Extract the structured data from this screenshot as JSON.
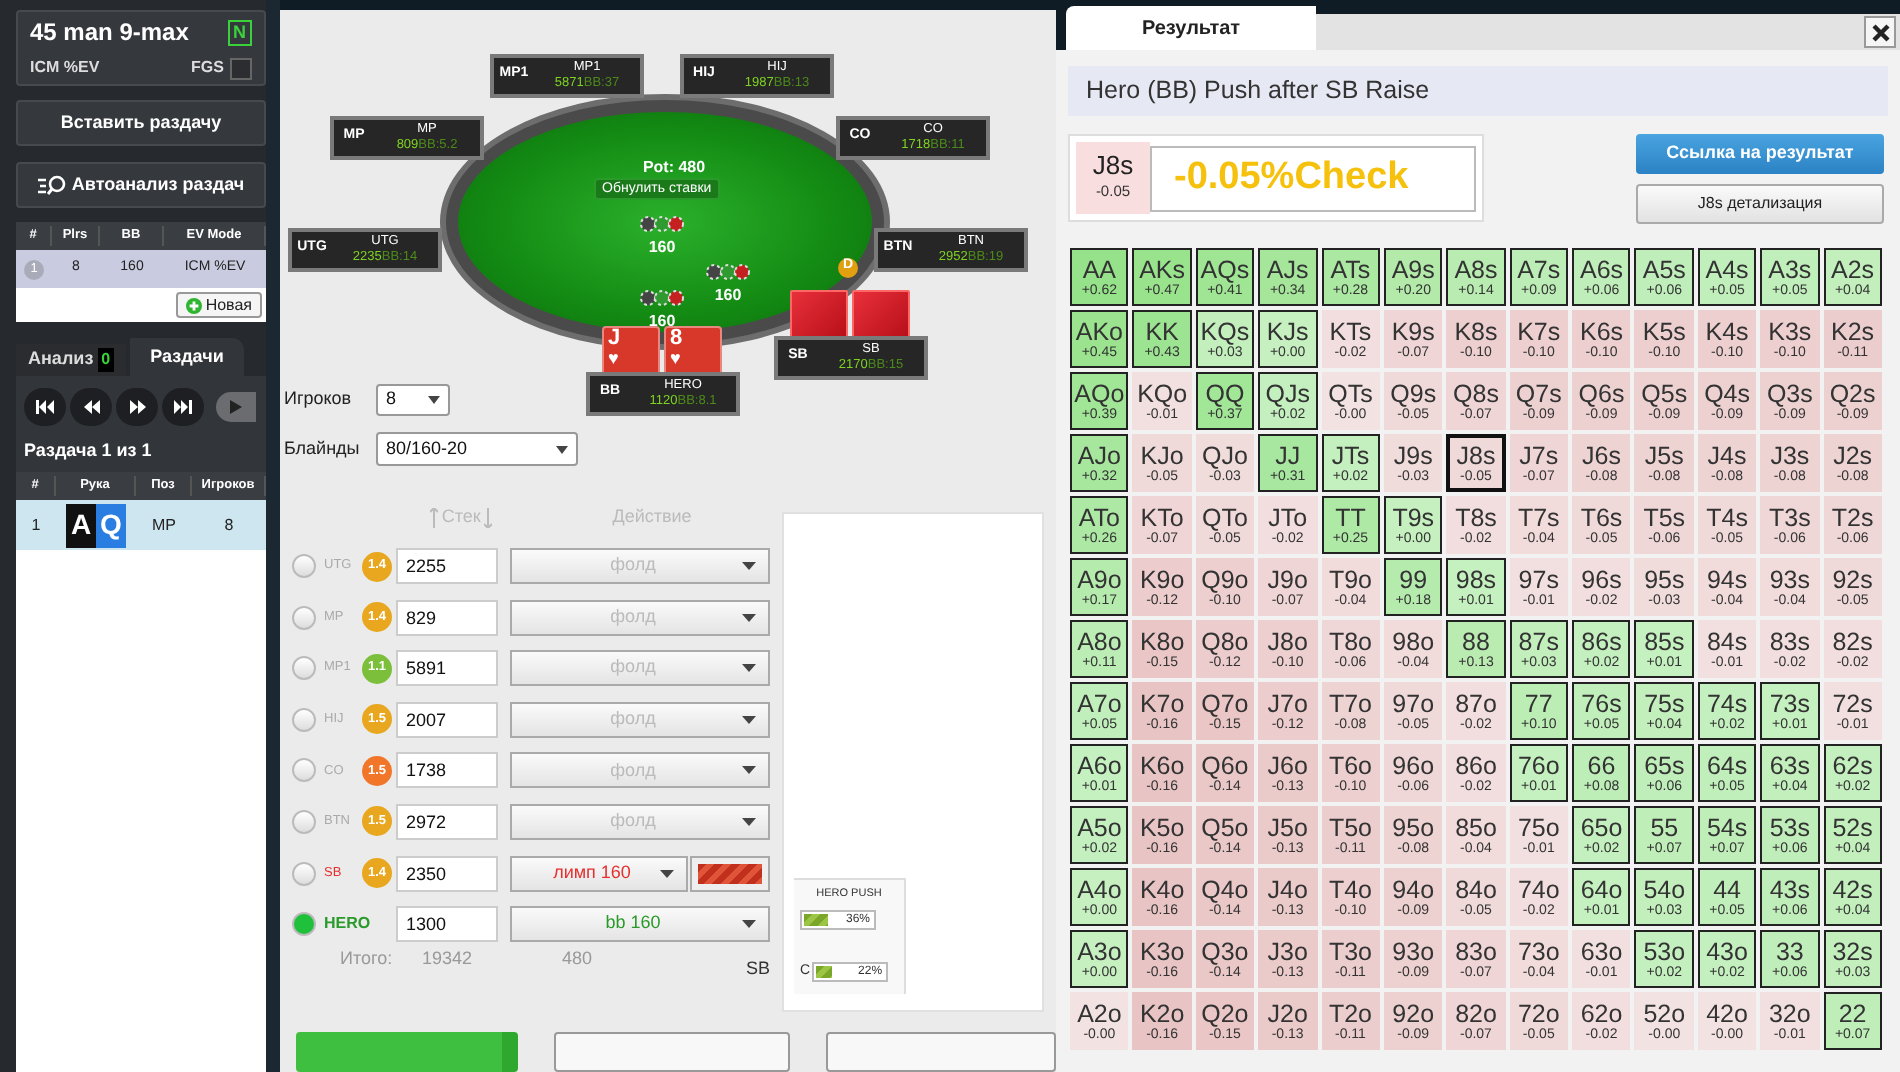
{
  "sidebar": {
    "tournament": "45 man 9-max",
    "badge": "N",
    "ev_mode": "ICM %EV",
    "fgs_label": "FGS",
    "fgs_checked": false,
    "paste_button": "Вставить раздачу",
    "autoanalysis_button": "Автоанализ раздач",
    "analyses": {
      "columns": [
        "#",
        "Plrs",
        "BB",
        "EV Mode"
      ],
      "rows": [
        {
          "cells": [
            "1",
            "8",
            "160",
            "ICM %EV"
          ],
          "selected": true
        }
      ],
      "new_button": "Новая"
    },
    "tabs": [
      {
        "label": "Анализ",
        "count": "0",
        "selected": false
      },
      {
        "label": "Раздачи",
        "selected": true
      }
    ],
    "hand_counter": "Раздача 1 из 1",
    "hands": {
      "columns": [
        "#",
        "Рука",
        "Поз",
        "Игроков"
      ],
      "rows": [
        {
          "number": "1",
          "cards": [
            {
              "rank": "A",
              "color": "#111111"
            },
            {
              "rank": "Q",
              "color": "#2a7de1"
            }
          ],
          "position": "MP",
          "players": "8",
          "selected": true
        }
      ]
    }
  },
  "table": {
    "seats": [
      {
        "tag": "MP1",
        "name": "MP1",
        "stack": "5871",
        "bb": "BB:37",
        "face_down_cards": false
      },
      {
        "tag": "HIJ",
        "name": "HIJ",
        "stack": "1987",
        "bb": "BB:13",
        "face_down_cards": false
      },
      {
        "tag": "MP",
        "name": "MP",
        "stack": "809",
        "bb": "BB:5.2",
        "face_down_cards": false
      },
      {
        "tag": "CO",
        "name": "CO",
        "stack": "1718",
        "bb": "BB:11",
        "face_down_cards": false
      },
      {
        "tag": "UTG",
        "name": "UTG",
        "stack": "2235",
        "bb": "BB:14",
        "face_down_cards": false
      },
      {
        "tag": "BTN",
        "name": "BTN",
        "stack": "2952",
        "bb": "BB:19",
        "face_down_cards": false
      },
      {
        "tag": "SB",
        "name": "SB",
        "stack": "2170",
        "bb": "BB:15",
        "face_down_cards": true
      },
      {
        "tag": "BB",
        "name": "HERO",
        "stack": "1120",
        "bb": "BB:8.1",
        "face_down_cards": false
      }
    ],
    "pot": "Pot: 480",
    "reset_button": "Обнулить ставки",
    "bets": [
      "160",
      "160",
      "160"
    ],
    "dealer": "D",
    "hero_cards": [
      {
        "rank": "J",
        "suit": "♥"
      },
      {
        "rank": "8",
        "suit": "♥"
      }
    ]
  },
  "players_select": {
    "label": "Игроков",
    "value": "8"
  },
  "blinds_select": {
    "label": "Блайнды",
    "value": "80/160-20"
  },
  "actions": {
    "stack_header": "Стек",
    "action_header": "Действие",
    "rows": [
      {
        "position": "UTG",
        "badge": "1.4",
        "color": "#e8a71f",
        "stack": "2255",
        "action": "фолд",
        "kind": "fold",
        "selected": false
      },
      {
        "position": "MP",
        "badge": "1.4",
        "color": "#e8a71f",
        "stack": "829",
        "action": "фолд",
        "kind": "fold",
        "selected": false
      },
      {
        "position": "MP1",
        "badge": "1.1",
        "color": "#7cbf3a",
        "stack": "5891",
        "action": "фолд",
        "kind": "fold",
        "selected": false
      },
      {
        "position": "HIJ",
        "badge": "1.5",
        "color": "#e8a71f",
        "stack": "2007",
        "action": "фолд",
        "kind": "fold",
        "selected": false
      },
      {
        "position": "CO",
        "badge": "1.5",
        "color": "#f2762a",
        "stack": "1738",
        "action": "фолд",
        "kind": "fold",
        "selected": false
      },
      {
        "position": "BTN",
        "badge": "1.5",
        "color": "#e8a71f",
        "stack": "2972",
        "action": "фолд",
        "kind": "fold",
        "selected": false
      },
      {
        "position": "SB",
        "badge": "1.4",
        "color": "#e8a71f",
        "stack": "2350",
        "action": "лимп 160",
        "kind": "limp",
        "level": 1,
        "selected": false
      },
      {
        "position": "HERO",
        "stack": "1300",
        "action": "bb 160",
        "kind": "hero",
        "selected": true
      }
    ],
    "total_label": "Итого:",
    "total_stack": "19342",
    "total_pot": "480",
    "sb_label": "SB"
  },
  "range_panel": {
    "title": "HERO PUSH",
    "bars": [
      {
        "value": "36%",
        "level": 0.36
      },
      {
        "label": "C",
        "value": "22%",
        "level": 0.22
      }
    ]
  },
  "result": {
    "tab": "Результат",
    "title": "Hero (BB) Push after SB Raise",
    "hand": "J8s",
    "hand_ev": "-0.05",
    "verdict": "-0.05%Check",
    "link_button": "Ссылка на результат",
    "details_button": "J8s детализация",
    "grid": [
      [
        {
          "hand": "AA",
          "ev": "+0.62",
          "push": true,
          "selected": false
        },
        {
          "hand": "AKs",
          "ev": "+0.47",
          "push": true,
          "selected": false
        },
        {
          "hand": "AQs",
          "ev": "+0.41",
          "push": true,
          "selected": false
        },
        {
          "hand": "AJs",
          "ev": "+0.34",
          "push": true,
          "selected": false
        },
        {
          "hand": "ATs",
          "ev": "+0.28",
          "push": true,
          "selected": false
        },
        {
          "hand": "A9s",
          "ev": "+0.20",
          "push": true,
          "selected": false
        },
        {
          "hand": "A8s",
          "ev": "+0.14",
          "push": true,
          "selected": false
        },
        {
          "hand": "A7s",
          "ev": "+0.09",
          "push": true,
          "selected": false
        },
        {
          "hand": "A6s",
          "ev": "+0.06",
          "push": true,
          "selected": false
        },
        {
          "hand": "A5s",
          "ev": "+0.06",
          "push": true,
          "selected": false
        },
        {
          "hand": "A4s",
          "ev": "+0.05",
          "push": true,
          "selected": false
        },
        {
          "hand": "A3s",
          "ev": "+0.05",
          "push": true,
          "selected": false
        },
        {
          "hand": "A2s",
          "ev": "+0.04",
          "push": true,
          "selected": false
        }
      ],
      [
        {
          "hand": "AKo",
          "ev": "+0.45",
          "push": true,
          "selected": false
        },
        {
          "hand": "KK",
          "ev": "+0.43",
          "push": true,
          "selected": false
        },
        {
          "hand": "KQs",
          "ev": "+0.03",
          "push": true,
          "selected": false
        },
        {
          "hand": "KJs",
          "ev": "+0.00",
          "push": true,
          "selected": false
        },
        {
          "hand": "KTs",
          "ev": "-0.02",
          "push": false,
          "selected": false
        },
        {
          "hand": "K9s",
          "ev": "-0.07",
          "push": false,
          "selected": false
        },
        {
          "hand": "K8s",
          "ev": "-0.10",
          "push": false,
          "selected": false
        },
        {
          "hand": "K7s",
          "ev": "-0.10",
          "push": false,
          "selected": false
        },
        {
          "hand": "K6s",
          "ev": "-0.10",
          "push": false,
          "selected": false
        },
        {
          "hand": "K5s",
          "ev": "-0.10",
          "push": false,
          "selected": false
        },
        {
          "hand": "K4s",
          "ev": "-0.10",
          "push": false,
          "selected": false
        },
        {
          "hand": "K3s",
          "ev": "-0.10",
          "push": false,
          "selected": false
        },
        {
          "hand": "K2s",
          "ev": "-0.11",
          "push": false,
          "selected": false
        }
      ],
      [
        {
          "hand": "AQo",
          "ev": "+0.39",
          "push": true,
          "selected": false
        },
        {
          "hand": "KQo",
          "ev": "-0.01",
          "push": false,
          "selected": false
        },
        {
          "hand": "QQ",
          "ev": "+0.37",
          "push": true,
          "selected": false
        },
        {
          "hand": "QJs",
          "ev": "+0.02",
          "push": true,
          "selected": false
        },
        {
          "hand": "QTs",
          "ev": "-0.00",
          "push": false,
          "selected": false
        },
        {
          "hand": "Q9s",
          "ev": "-0.05",
          "push": false,
          "selected": false
        },
        {
          "hand": "Q8s",
          "ev": "-0.07",
          "push": false,
          "selected": false
        },
        {
          "hand": "Q7s",
          "ev": "-0.09",
          "push": false,
          "selected": false
        },
        {
          "hand": "Q6s",
          "ev": "-0.09",
          "push": false,
          "selected": false
        },
        {
          "hand": "Q5s",
          "ev": "-0.09",
          "push": false,
          "selected": false
        },
        {
          "hand": "Q4s",
          "ev": "-0.09",
          "push": false,
          "selected": false
        },
        {
          "hand": "Q3s",
          "ev": "-0.09",
          "push": false,
          "selected": false
        },
        {
          "hand": "Q2s",
          "ev": "-0.09",
          "push": false,
          "selected": false
        }
      ],
      [
        {
          "hand": "AJo",
          "ev": "+0.32",
          "push": true,
          "selected": false
        },
        {
          "hand": "KJo",
          "ev": "-0.05",
          "push": false,
          "selected": false
        },
        {
          "hand": "QJo",
          "ev": "-0.03",
          "push": false,
          "selected": false
        },
        {
          "hand": "JJ",
          "ev": "+0.31",
          "push": true,
          "selected": false
        },
        {
          "hand": "JTs",
          "ev": "+0.02",
          "push": true,
          "selected": false
        },
        {
          "hand": "J9s",
          "ev": "-0.03",
          "push": false,
          "selected": false
        },
        {
          "hand": "J8s",
          "ev": "-0.05",
          "push": false,
          "selected": true
        },
        {
          "hand": "J7s",
          "ev": "-0.07",
          "push": false,
          "selected": false
        },
        {
          "hand": "J6s",
          "ev": "-0.08",
          "push": false,
          "selected": false
        },
        {
          "hand": "J5s",
          "ev": "-0.08",
          "push": false,
          "selected": false
        },
        {
          "hand": "J4s",
          "ev": "-0.08",
          "push": false,
          "selected": false
        },
        {
          "hand": "J3s",
          "ev": "-0.08",
          "push": false,
          "selected": false
        },
        {
          "hand": "J2s",
          "ev": "-0.08",
          "push": false,
          "selected": false
        }
      ],
      [
        {
          "hand": "ATo",
          "ev": "+0.26",
          "push": true,
          "selected": false
        },
        {
          "hand": "KTo",
          "ev": "-0.07",
          "push": false,
          "selected": false
        },
        {
          "hand": "QTo",
          "ev": "-0.05",
          "push": false,
          "selected": false
        },
        {
          "hand": "JTo",
          "ev": "-0.02",
          "push": false,
          "selected": false
        },
        {
          "hand": "TT",
          "ev": "+0.25",
          "push": true,
          "selected": false
        },
        {
          "hand": "T9s",
          "ev": "+0.00",
          "push": true,
          "selected": false
        },
        {
          "hand": "T8s",
          "ev": "-0.02",
          "push": false,
          "selected": false
        },
        {
          "hand": "T7s",
          "ev": "-0.04",
          "push": false,
          "selected": false
        },
        {
          "hand": "T6s",
          "ev": "-0.05",
          "push": false,
          "selected": false
        },
        {
          "hand": "T5s",
          "ev": "-0.06",
          "push": false,
          "selected": false
        },
        {
          "hand": "T4s",
          "ev": "-0.05",
          "push": false,
          "selected": false
        },
        {
          "hand": "T3s",
          "ev": "-0.06",
          "push": false,
          "selected": false
        },
        {
          "hand": "T2s",
          "ev": "-0.06",
          "push": false,
          "selected": false
        }
      ],
      [
        {
          "hand": "A9o",
          "ev": "+0.17",
          "push": true,
          "selected": false
        },
        {
          "hand": "K9o",
          "ev": "-0.12",
          "push": false,
          "selected": false
        },
        {
          "hand": "Q9o",
          "ev": "-0.10",
          "push": false,
          "selected": false
        },
        {
          "hand": "J9o",
          "ev": "-0.07",
          "push": false,
          "selected": false
        },
        {
          "hand": "T9o",
          "ev": "-0.04",
          "push": false,
          "selected": false
        },
        {
          "hand": "99",
          "ev": "+0.18",
          "push": true,
          "selected": false
        },
        {
          "hand": "98s",
          "ev": "+0.01",
          "push": true,
          "selected": false
        },
        {
          "hand": "97s",
          "ev": "-0.01",
          "push": false,
          "selected": false
        },
        {
          "hand": "96s",
          "ev": "-0.02",
          "push": false,
          "selected": false
        },
        {
          "hand": "95s",
          "ev": "-0.03",
          "push": false,
          "selected": false
        },
        {
          "hand": "94s",
          "ev": "-0.04",
          "push": false,
          "selected": false
        },
        {
          "hand": "93s",
          "ev": "-0.04",
          "push": false,
          "selected": false
        },
        {
          "hand": "92s",
          "ev": "-0.05",
          "push": false,
          "selected": false
        }
      ],
      [
        {
          "hand": "A8o",
          "ev": "+0.11",
          "push": true,
          "selected": false
        },
        {
          "hand": "K8o",
          "ev": "-0.15",
          "push": false,
          "selected": false
        },
        {
          "hand": "Q8o",
          "ev": "-0.12",
          "push": false,
          "selected": false
        },
        {
          "hand": "J8o",
          "ev": "-0.10",
          "push": false,
          "selected": false
        },
        {
          "hand": "T8o",
          "ev": "-0.06",
          "push": false,
          "selected": false
        },
        {
          "hand": "98o",
          "ev": "-0.04",
          "push": false,
          "selected": false
        },
        {
          "hand": "88",
          "ev": "+0.13",
          "push": true,
          "selected": false
        },
        {
          "hand": "87s",
          "ev": "+0.03",
          "push": true,
          "selected": false
        },
        {
          "hand": "86s",
          "ev": "+0.02",
          "push": true,
          "selected": false
        },
        {
          "hand": "85s",
          "ev": "+0.01",
          "push": true,
          "selected": false
        },
        {
          "hand": "84s",
          "ev": "-0.01",
          "push": false,
          "selected": false
        },
        {
          "hand": "83s",
          "ev": "-0.02",
          "push": false,
          "selected": false
        },
        {
          "hand": "82s",
          "ev": "-0.02",
          "push": false,
          "selected": false
        }
      ],
      [
        {
          "hand": "A7o",
          "ev": "+0.05",
          "push": true,
          "selected": false
        },
        {
          "hand": "K7o",
          "ev": "-0.16",
          "push": false,
          "selected": false
        },
        {
          "hand": "Q7o",
          "ev": "-0.15",
          "push": false,
          "selected": false
        },
        {
          "hand": "J7o",
          "ev": "-0.12",
          "push": false,
          "selected": false
        },
        {
          "hand": "T7o",
          "ev": "-0.08",
          "push": false,
          "selected": false
        },
        {
          "hand": "97o",
          "ev": "-0.05",
          "push": false,
          "selected": false
        },
        {
          "hand": "87o",
          "ev": "-0.02",
          "push": false,
          "selected": false
        },
        {
          "hand": "77",
          "ev": "+0.10",
          "push": true,
          "selected": false
        },
        {
          "hand": "76s",
          "ev": "+0.05",
          "push": true,
          "selected": false
        },
        {
          "hand": "75s",
          "ev": "+0.04",
          "push": true,
          "selected": false
        },
        {
          "hand": "74s",
          "ev": "+0.02",
          "push": true,
          "selected": false
        },
        {
          "hand": "73s",
          "ev": "+0.01",
          "push": true,
          "selected": false
        },
        {
          "hand": "72s",
          "ev": "-0.01",
          "push": false,
          "selected": false
        }
      ],
      [
        {
          "hand": "A6o",
          "ev": "+0.01",
          "push": true,
          "selected": false
        },
        {
          "hand": "K6o",
          "ev": "-0.16",
          "push": false,
          "selected": false
        },
        {
          "hand": "Q6o",
          "ev": "-0.14",
          "push": false,
          "selected": false
        },
        {
          "hand": "J6o",
          "ev": "-0.13",
          "push": false,
          "selected": false
        },
        {
          "hand": "T6o",
          "ev": "-0.10",
          "push": false,
          "selected": false
        },
        {
          "hand": "96o",
          "ev": "-0.06",
          "push": false,
          "selected": false
        },
        {
          "hand": "86o",
          "ev": "-0.02",
          "push": false,
          "selected": false
        },
        {
          "hand": "76o",
          "ev": "+0.01",
          "push": true,
          "selected": false
        },
        {
          "hand": "66",
          "ev": "+0.08",
          "push": true,
          "selected": false
        },
        {
          "hand": "65s",
          "ev": "+0.06",
          "push": true,
          "selected": false
        },
        {
          "hand": "64s",
          "ev": "+0.05",
          "push": true,
          "selected": false
        },
        {
          "hand": "63s",
          "ev": "+0.04",
          "push": true,
          "selected": false
        },
        {
          "hand": "62s",
          "ev": "+0.02",
          "push": true,
          "selected": false
        }
      ],
      [
        {
          "hand": "A5o",
          "ev": "+0.02",
          "push": true,
          "selected": false
        },
        {
          "hand": "K5o",
          "ev": "-0.16",
          "push": false,
          "selected": false
        },
        {
          "hand": "Q5o",
          "ev": "-0.14",
          "push": false,
          "selected": false
        },
        {
          "hand": "J5o",
          "ev": "-0.13",
          "push": false,
          "selected": false
        },
        {
          "hand": "T5o",
          "ev": "-0.11",
          "push": false,
          "selected": false
        },
        {
          "hand": "95o",
          "ev": "-0.08",
          "push": false,
          "selected": false
        },
        {
          "hand": "85o",
          "ev": "-0.04",
          "push": false,
          "selected": false
        },
        {
          "hand": "75o",
          "ev": "-0.01",
          "push": false,
          "selected": false
        },
        {
          "hand": "65o",
          "ev": "+0.02",
          "push": true,
          "selected": false
        },
        {
          "hand": "55",
          "ev": "+0.07",
          "push": true,
          "selected": false
        },
        {
          "hand": "54s",
          "ev": "+0.07",
          "push": true,
          "selected": false
        },
        {
          "hand": "53s",
          "ev": "+0.06",
          "push": true,
          "selected": false
        },
        {
          "hand": "52s",
          "ev": "+0.04",
          "push": true,
          "selected": false
        }
      ],
      [
        {
          "hand": "A4o",
          "ev": "+0.00",
          "push": true,
          "selected": false
        },
        {
          "hand": "K4o",
          "ev": "-0.16",
          "push": false,
          "selected": false
        },
        {
          "hand": "Q4o",
          "ev": "-0.14",
          "push": false,
          "selected": false
        },
        {
          "hand": "J4o",
          "ev": "-0.13",
          "push": false,
          "selected": false
        },
        {
          "hand": "T4o",
          "ev": "-0.10",
          "push": false,
          "selected": false
        },
        {
          "hand": "94o",
          "ev": "-0.09",
          "push": false,
          "selected": false
        },
        {
          "hand": "84o",
          "ev": "-0.05",
          "push": false,
          "selected": false
        },
        {
          "hand": "74o",
          "ev": "-0.02",
          "push": false,
          "selected": false
        },
        {
          "hand": "64o",
          "ev": "+0.01",
          "push": true,
          "selected": false
        },
        {
          "hand": "54o",
          "ev": "+0.03",
          "push": true,
          "selected": false
        },
        {
          "hand": "44",
          "ev": "+0.05",
          "push": true,
          "selected": false
        },
        {
          "hand": "43s",
          "ev": "+0.06",
          "push": true,
          "selected": false
        },
        {
          "hand": "42s",
          "ev": "+0.04",
          "push": true,
          "selected": false
        }
      ],
      [
        {
          "hand": "A3o",
          "ev": "+0.00",
          "push": true,
          "selected": false
        },
        {
          "hand": "K3o",
          "ev": "-0.16",
          "push": false,
          "selected": false
        },
        {
          "hand": "Q3o",
          "ev": "-0.14",
          "push": false,
          "selected": false
        },
        {
          "hand": "J3o",
          "ev": "-0.13",
          "push": false,
          "selected": false
        },
        {
          "hand": "T3o",
          "ev": "-0.11",
          "push": false,
          "selected": false
        },
        {
          "hand": "93o",
          "ev": "-0.09",
          "push": false,
          "selected": false
        },
        {
          "hand": "83o",
          "ev": "-0.07",
          "push": false,
          "selected": false
        },
        {
          "hand": "73o",
          "ev": "-0.04",
          "push": false,
          "selected": false
        },
        {
          "hand": "63o",
          "ev": "-0.01",
          "push": false,
          "selected": false
        },
        {
          "hand": "53o",
          "ev": "+0.02",
          "push": true,
          "selected": false
        },
        {
          "hand": "43o",
          "ev": "+0.02",
          "push": true,
          "selected": false
        },
        {
          "hand": "33",
          "ev": "+0.06",
          "push": true,
          "selected": false
        },
        {
          "hand": "32s",
          "ev": "+0.03",
          "push": true,
          "selected": false
        }
      ],
      [
        {
          "hand": "A2o",
          "ev": "-0.00",
          "push": false,
          "selected": false
        },
        {
          "hand": "K2o",
          "ev": "-0.16",
          "push": false,
          "selected": false
        },
        {
          "hand": "Q2o",
          "ev": "-0.15",
          "push": false,
          "selected": false
        },
        {
          "hand": "J2o",
          "ev": "-0.13",
          "push": false,
          "selected": false
        },
        {
          "hand": "T2o",
          "ev": "-0.11",
          "push": false,
          "selected": false
        },
        {
          "hand": "92o",
          "ev": "-0.09",
          "push": false,
          "selected": false
        },
        {
          "hand": "82o",
          "ev": "-0.07",
          "push": false,
          "selected": false
        },
        {
          "hand": "72o",
          "ev": "-0.05",
          "push": false,
          "selected": false
        },
        {
          "hand": "62o",
          "ev": "-0.02",
          "push": false,
          "selected": false
        },
        {
          "hand": "52o",
          "ev": "-0.00",
          "push": false,
          "selected": false
        },
        {
          "hand": "42o",
          "ev": "-0.00",
          "push": false,
          "selected": false
        },
        {
          "hand": "32o",
          "ev": "-0.01",
          "push": false,
          "selected": false
        },
        {
          "hand": "22",
          "ev": "+0.07",
          "push": true,
          "selected": false
        }
      ]
    ]
  }
}
